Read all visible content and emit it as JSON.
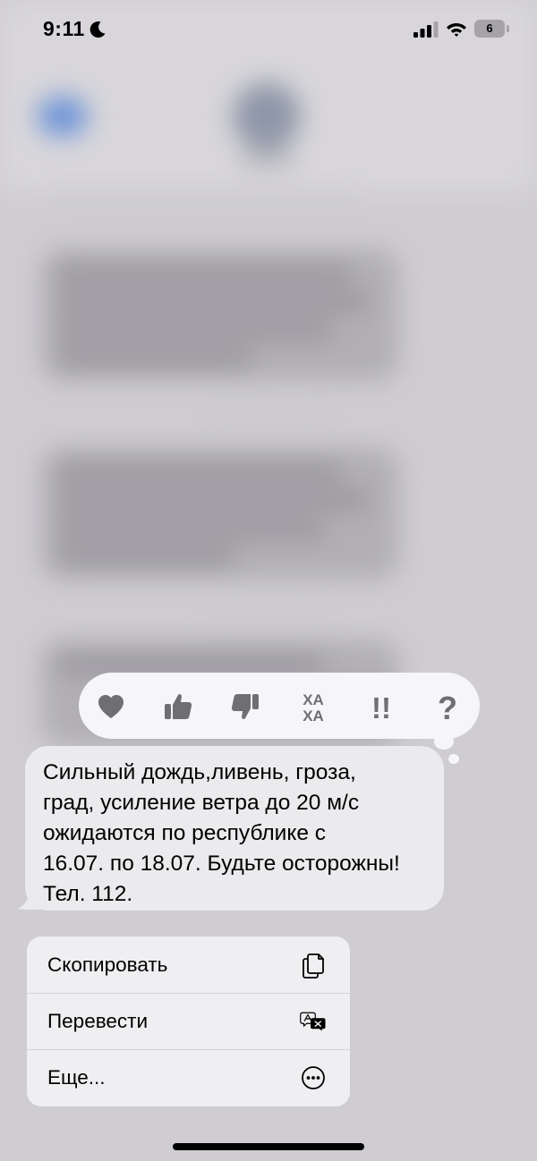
{
  "status_bar": {
    "time": "9:11",
    "battery_level": "6"
  },
  "tapback": {
    "reactions": [
      {
        "name": "heart-icon",
        "label": "Heart"
      },
      {
        "name": "thumbs-up-icon",
        "label": "Like"
      },
      {
        "name": "thumbs-down-icon",
        "label": "Dislike"
      },
      {
        "name": "haha-icon",
        "label": "ХА ХА"
      },
      {
        "name": "exclamation-icon",
        "label": "!!"
      },
      {
        "name": "question-icon",
        "label": "?"
      }
    ],
    "haha_text_top": "ХА",
    "haha_text_bottom": "ХА",
    "exclamation_text": "!!",
    "question_text": "?"
  },
  "message": {
    "text": "Сильный дождь,ливень, гроза,\nград, усиление ветра до 20 м/с\nожидаются по республике с\n16.07. по 18.07. Будьте осторожны!\nТел. 112."
  },
  "context_menu": {
    "items": [
      {
        "label": "Скопировать",
        "icon": "copy-icon"
      },
      {
        "label": "Перевести",
        "icon": "translate-icon"
      },
      {
        "label": "Еще...",
        "icon": "more-icon"
      }
    ]
  },
  "colors": {
    "background": "#cfcdd2",
    "bubble": "#ebeaed",
    "menu": "#efeef1",
    "tapback_bar": "#f6f6f8",
    "tapback_icon": "#6e6e73",
    "accent_blue": "#6f95d8"
  }
}
